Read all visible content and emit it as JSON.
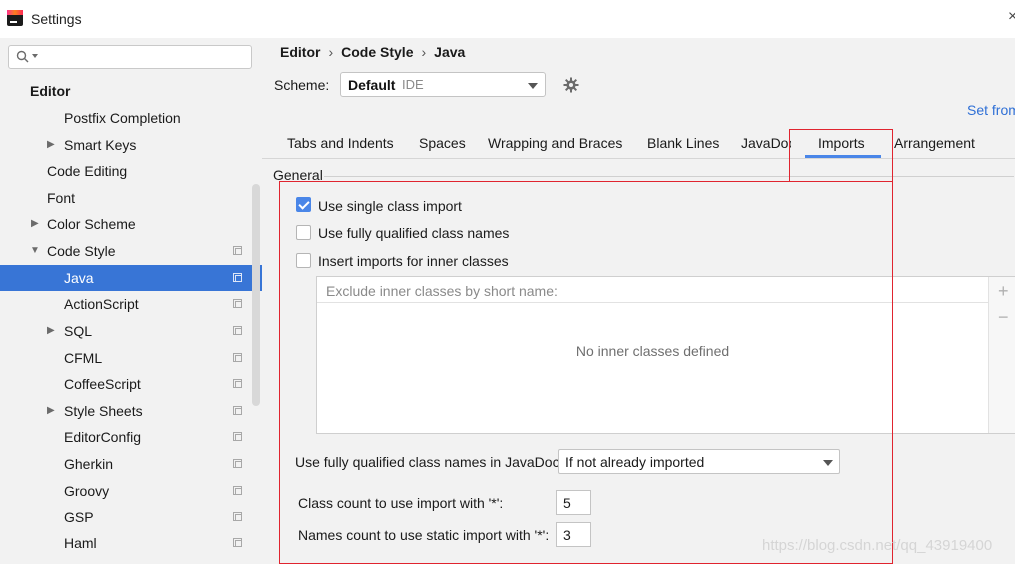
{
  "window": {
    "title": "Settings",
    "close_glyph": "×"
  },
  "sidebar": {
    "search_placeholder": "",
    "items": [
      {
        "label": "Editor",
        "name": "sidebar-item-editor"
      },
      {
        "label": "Postfix Completion",
        "name": "sidebar-item-postfix-completion"
      },
      {
        "label": "Smart Keys",
        "name": "sidebar-item-smart-keys"
      },
      {
        "label": "Code Editing",
        "name": "sidebar-item-code-editing"
      },
      {
        "label": "Font",
        "name": "sidebar-item-font"
      },
      {
        "label": "Color Scheme",
        "name": "sidebar-item-color-scheme"
      },
      {
        "label": "Code Style",
        "name": "sidebar-item-code-style"
      },
      {
        "label": "Java",
        "name": "sidebar-item-java"
      },
      {
        "label": "ActionScript",
        "name": "sidebar-item-actionscript"
      },
      {
        "label": "SQL",
        "name": "sidebar-item-sql"
      },
      {
        "label": "CFML",
        "name": "sidebar-item-cfml"
      },
      {
        "label": "CoffeeScript",
        "name": "sidebar-item-coffeescript"
      },
      {
        "label": "Style Sheets",
        "name": "sidebar-item-style-sheets"
      },
      {
        "label": "EditorConfig",
        "name": "sidebar-item-editorconfig"
      },
      {
        "label": "Gherkin",
        "name": "sidebar-item-gherkin"
      },
      {
        "label": "Groovy",
        "name": "sidebar-item-groovy"
      },
      {
        "label": "GSP",
        "name": "sidebar-item-gsp"
      },
      {
        "label": "Haml",
        "name": "sidebar-item-haml"
      }
    ],
    "selected": "Java"
  },
  "breadcrumb": [
    "Editor",
    "Code Style",
    "Java"
  ],
  "breadcrumb_sep": "›",
  "scheme": {
    "label": "Scheme:",
    "value": "Default",
    "tag": "IDE"
  },
  "set_from_label": "Set from...",
  "tabs": [
    "Tabs and Indents",
    "Spaces",
    "Wrapping and Braces",
    "Blank Lines",
    "JavaDoc",
    "Imports",
    "Arrangement"
  ],
  "active_tab": "Imports",
  "general": {
    "title": "General",
    "checkboxes": [
      {
        "label": "Use single class import",
        "checked": true
      },
      {
        "label": "Use fully qualified class names",
        "checked": false
      },
      {
        "label": "Insert imports for inner classes",
        "checked": false
      }
    ],
    "exclude_list": {
      "header": "Exclude inner classes by short name:",
      "empty_text": "No inner classes defined",
      "add_glyph": "+",
      "remove_glyph": "−"
    },
    "javadoc_qualified": {
      "label": "Use fully qualified class names in JavaDoc:",
      "value": "If not already imported"
    },
    "class_count": {
      "label": "Class count to use import with '*':",
      "value": "5"
    },
    "names_count": {
      "label": "Names count to use static import with '*':",
      "value": "3"
    }
  },
  "colors": {
    "accent": "#3875d6",
    "highlight_box": "#e0242f",
    "link": "#2e6fd6"
  },
  "watermark": "https://blog.csdn.net/qq_43919400"
}
